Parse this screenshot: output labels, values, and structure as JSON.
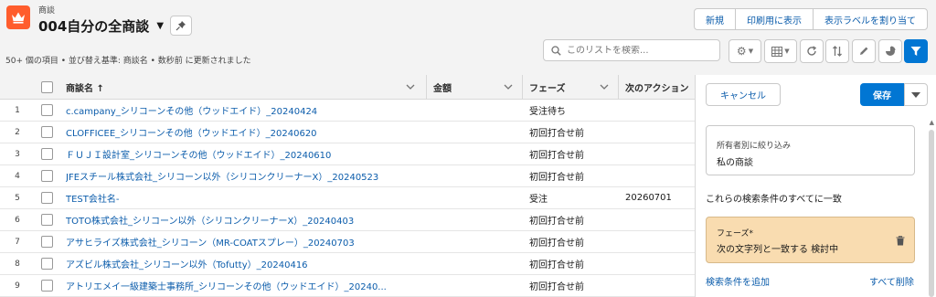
{
  "header": {
    "object_label": "商談",
    "list_title": "004自分の全商談",
    "meta": "50+ 個の項目 • 並び替え基準: 商談名 • 数秒前 に更新されました",
    "actions": [
      "新規",
      "印刷用に表示",
      "表示ラベルを割り当て"
    ]
  },
  "search": {
    "placeholder": "このリストを検索..."
  },
  "table": {
    "columns": [
      "商談名 ↑",
      "金額",
      "フェーズ",
      "次のアクション"
    ],
    "rows": [
      {
        "num": "1",
        "name": "c.campany_シリコーンその他（ウッドエイド）_20240424",
        "amount": "",
        "phase": "受注待ち",
        "next": ""
      },
      {
        "num": "2",
        "name": "CLOFFICEE_シリコーンその他（ウッドエイド）_20240620",
        "amount": "",
        "phase": "初回打合せ前",
        "next": ""
      },
      {
        "num": "3",
        "name": "ＦＵＪＩ設計室_シリコーンその他（ウッドエイド）_20240610",
        "amount": "",
        "phase": "初回打合せ前",
        "next": ""
      },
      {
        "num": "4",
        "name": "JFEスチール株式会社_シリコーン以外（シリコンクリーナーX）_20240523",
        "amount": "",
        "phase": "初回打合せ前",
        "next": ""
      },
      {
        "num": "5",
        "name": "TEST会社名-",
        "amount": "",
        "phase": "受注",
        "next": "20260701"
      },
      {
        "num": "6",
        "name": "TOTO株式会社_シリコーン以外（シリコンクリーナーX）_20240403",
        "amount": "",
        "phase": "初回打合せ前",
        "next": ""
      },
      {
        "num": "7",
        "name": "アサヒライズ株式会社_シリコーン（MR-COATスプレー）_20240703",
        "amount": "",
        "phase": "初回打合せ前",
        "next": ""
      },
      {
        "num": "8",
        "name": "アズビル株式会社_シリコーン以外（Tofutty）_20240416",
        "amount": "",
        "phase": "初回打合せ前",
        "next": ""
      },
      {
        "num": "9",
        "name": "アトリエメイ一級建築士事務所_シリコーンその他（ウッドエイド）_20240...",
        "amount": "",
        "phase": "初回打合せ前",
        "next": ""
      }
    ]
  },
  "panel": {
    "cancel": "キャンセル",
    "save": "保存",
    "owner_label": "所有者別に絞り込み",
    "owner_value": "私の商談",
    "match_text": "これらの検索条件のすべてに一致",
    "condition_label": "フェーズ*",
    "condition_value": "次の文字列と一致する 検討中",
    "add_condition": "検索条件を追加",
    "delete_all": "すべて削除"
  },
  "colors": {
    "accent": "#0176d3",
    "object_icon": "#ff5d2d",
    "condition_bg": "#f9dcb0",
    "link": "#0b5cab"
  },
  "icons": [
    "crown-icon",
    "pin-icon",
    "search-icon",
    "gear-icon",
    "table-view-icon",
    "refresh-icon",
    "sort-icon",
    "edit-icon",
    "chart-icon",
    "filter-icon",
    "trash-icon"
  ]
}
